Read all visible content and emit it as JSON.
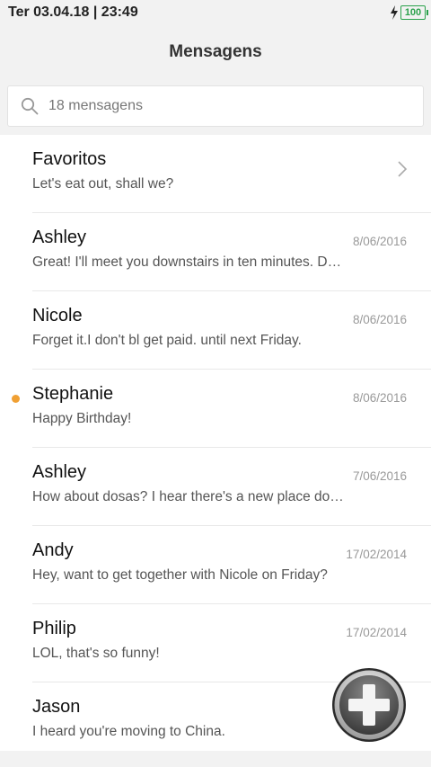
{
  "status_bar": {
    "datetime": "Ter 03.04.18 | 23:49",
    "battery": "100",
    "charging_icon": "bolt-icon"
  },
  "header": {
    "title": "Mensagens"
  },
  "search": {
    "icon": "search-icon",
    "text": "18 mensagens"
  },
  "conversations": [
    {
      "name": "Favoritos",
      "preview": "Let's eat out, shall we?",
      "date": "",
      "chevron": true,
      "unread": false
    },
    {
      "name": "Ashley",
      "preview": "Great! I'll meet you downstairs in ten minutes. D…",
      "date": "8/06/2016",
      "unread": false
    },
    {
      "name": "Nicole",
      "preview": "Forget it.I don't bl get paid. until next Friday.",
      "date": "8/06/2016",
      "unread": false
    },
    {
      "name": "Stephanie",
      "preview": "Happy Birthday!",
      "date": "8/06/2016",
      "unread": true
    },
    {
      "name": "Ashley",
      "preview": "How about dosas? I hear there's a new place do…",
      "date": "7/06/2016",
      "unread": false
    },
    {
      "name": "Andy",
      "preview": "Hey, want to get together with Nicole on Friday?",
      "date": "17/02/2014",
      "unread": false
    },
    {
      "name": "Philip",
      "preview": "LOL, that's so funny!",
      "date": "17/02/2014",
      "unread": false
    },
    {
      "name": "Jason",
      "preview": "I heard you're moving to China.",
      "date": "",
      "unread": false
    }
  ],
  "fab": {
    "icon": "plus-icon"
  },
  "colors": {
    "unread": "#f0a033",
    "battery": "#2aa14b"
  }
}
